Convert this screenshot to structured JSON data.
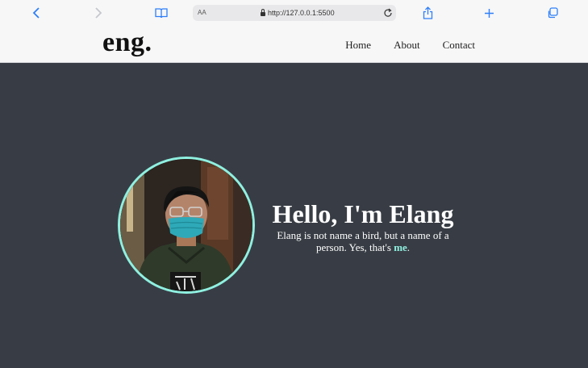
{
  "browser": {
    "url_aa": "AA",
    "url": "http://127.0.0.1:5500"
  },
  "site": {
    "logo": "eng.",
    "nav": [
      "Home",
      "About",
      "Contact"
    ]
  },
  "hero": {
    "title": "Hello, I'm Elang",
    "subtitle_before": "Elang is not name a bird, but a name of a person. Yes, that's ",
    "subtitle_highlight": "me",
    "subtitle_after": "."
  },
  "colors": {
    "background": "#383d45",
    "accent": "#8ff0e0",
    "browser_blue": "#2d7ff9"
  },
  "icons": [
    "back-icon",
    "forward-icon",
    "book-icon",
    "lock-icon",
    "reload-icon",
    "share-icon",
    "new-tab-icon",
    "tabs-icon"
  ]
}
